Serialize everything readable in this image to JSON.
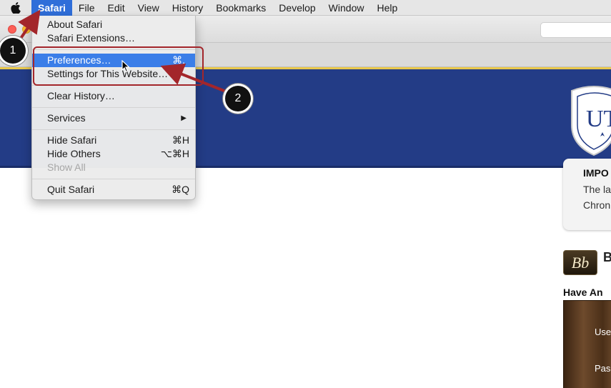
{
  "menubar": {
    "apple_icon": "apple-logo-icon",
    "items": [
      "Safari",
      "File",
      "Edit",
      "View",
      "History",
      "Bookmarks",
      "Develop",
      "Window",
      "Help"
    ]
  },
  "dropdown": {
    "about": "About Safari",
    "extensions": "Safari Extensions…",
    "preferences": "Preferences…",
    "preferences_shortcut": "⌘,",
    "site_settings": "Settings for This Website…",
    "clear_history": "Clear History…",
    "services": "Services",
    "services_arrow": "▶",
    "hide_safari": "Hide Safari",
    "hide_safari_shortcut": "⌘H",
    "hide_others": "Hide Others",
    "hide_others_shortcut": "⌥⌘H",
    "show_all": "Show All",
    "quit": "Quit Safari",
    "quit_shortcut": "⌘Q"
  },
  "callouts": {
    "step1": "1",
    "step2": "2",
    "accent": "#a3262b"
  },
  "page": {
    "logo_text": "UT",
    "notice_title": "IMPO",
    "notice_line1": "The la",
    "notice_line2": "Chron",
    "bb_logo": "Bb",
    "bb_title": "B",
    "have_an": "Have An",
    "username_label": "Use",
    "password_label": "Pas",
    "banner_color": "#233c86"
  }
}
